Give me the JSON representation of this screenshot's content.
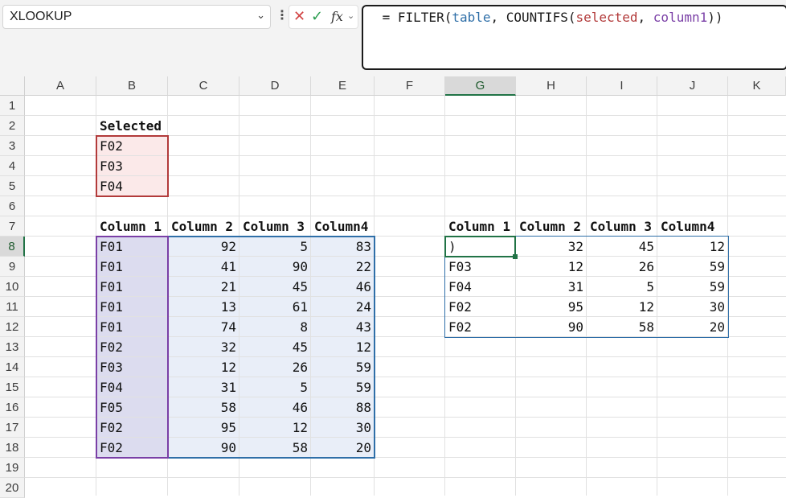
{
  "formula_bar": {
    "name_box": "XLOOKUP",
    "formula": {
      "prefix": " = FILTER(",
      "ref_table": "table",
      "mid": ", COUNTIFS(",
      "ref_selected": "selected",
      "sep": ", ",
      "ref_column": "column1",
      "suffix": "))"
    }
  },
  "columns": [
    "A",
    "B",
    "C",
    "D",
    "E",
    "F",
    "G",
    "H",
    "I",
    "J",
    "K"
  ],
  "active_column": "G",
  "rows": [
    "1",
    "2",
    "3",
    "4",
    "5",
    "6",
    "7",
    "8",
    "9",
    "10",
    "11",
    "12",
    "13",
    "14",
    "15",
    "16",
    "17",
    "18",
    "19",
    "20"
  ],
  "active_row": "8",
  "selected_block": {
    "header": "Selected",
    "items": [
      "F02",
      "F03",
      "F04"
    ]
  },
  "source_table": {
    "headers": [
      "Column 1",
      "Column 2",
      "Column 3",
      "Column4"
    ],
    "rows": [
      [
        "F01",
        "92",
        "5",
        "83"
      ],
      [
        "F01",
        "41",
        "90",
        "22"
      ],
      [
        "F01",
        "21",
        "45",
        "46"
      ],
      [
        "F01",
        "13",
        "61",
        "24"
      ],
      [
        "F01",
        "74",
        "8",
        "43"
      ],
      [
        "F02",
        "32",
        "45",
        "12"
      ],
      [
        "F03",
        "12",
        "26",
        "59"
      ],
      [
        "F04",
        "31",
        "5",
        "59"
      ],
      [
        "F05",
        "58",
        "46",
        "88"
      ],
      [
        "F02",
        "95",
        "12",
        "30"
      ],
      [
        "F02",
        "90",
        "58",
        "20"
      ]
    ]
  },
  "result_table": {
    "headers": [
      "Column 1",
      "Column 2",
      "Column 3",
      "Column4"
    ],
    "rows": [
      [
        ")",
        "32",
        "45",
        "12"
      ],
      [
        "F03",
        "12",
        "26",
        "59"
      ],
      [
        "F04",
        "31",
        "5",
        "59"
      ],
      [
        "F02",
        "95",
        "12",
        "30"
      ],
      [
        "F02",
        "90",
        "58",
        "20"
      ]
    ]
  },
  "colors": {
    "active_cell_border": "#217346",
    "selected_range_border": "#b23a3a",
    "table_range_border": "#2f6fa8",
    "column_range_border": "#7a3fa6"
  }
}
